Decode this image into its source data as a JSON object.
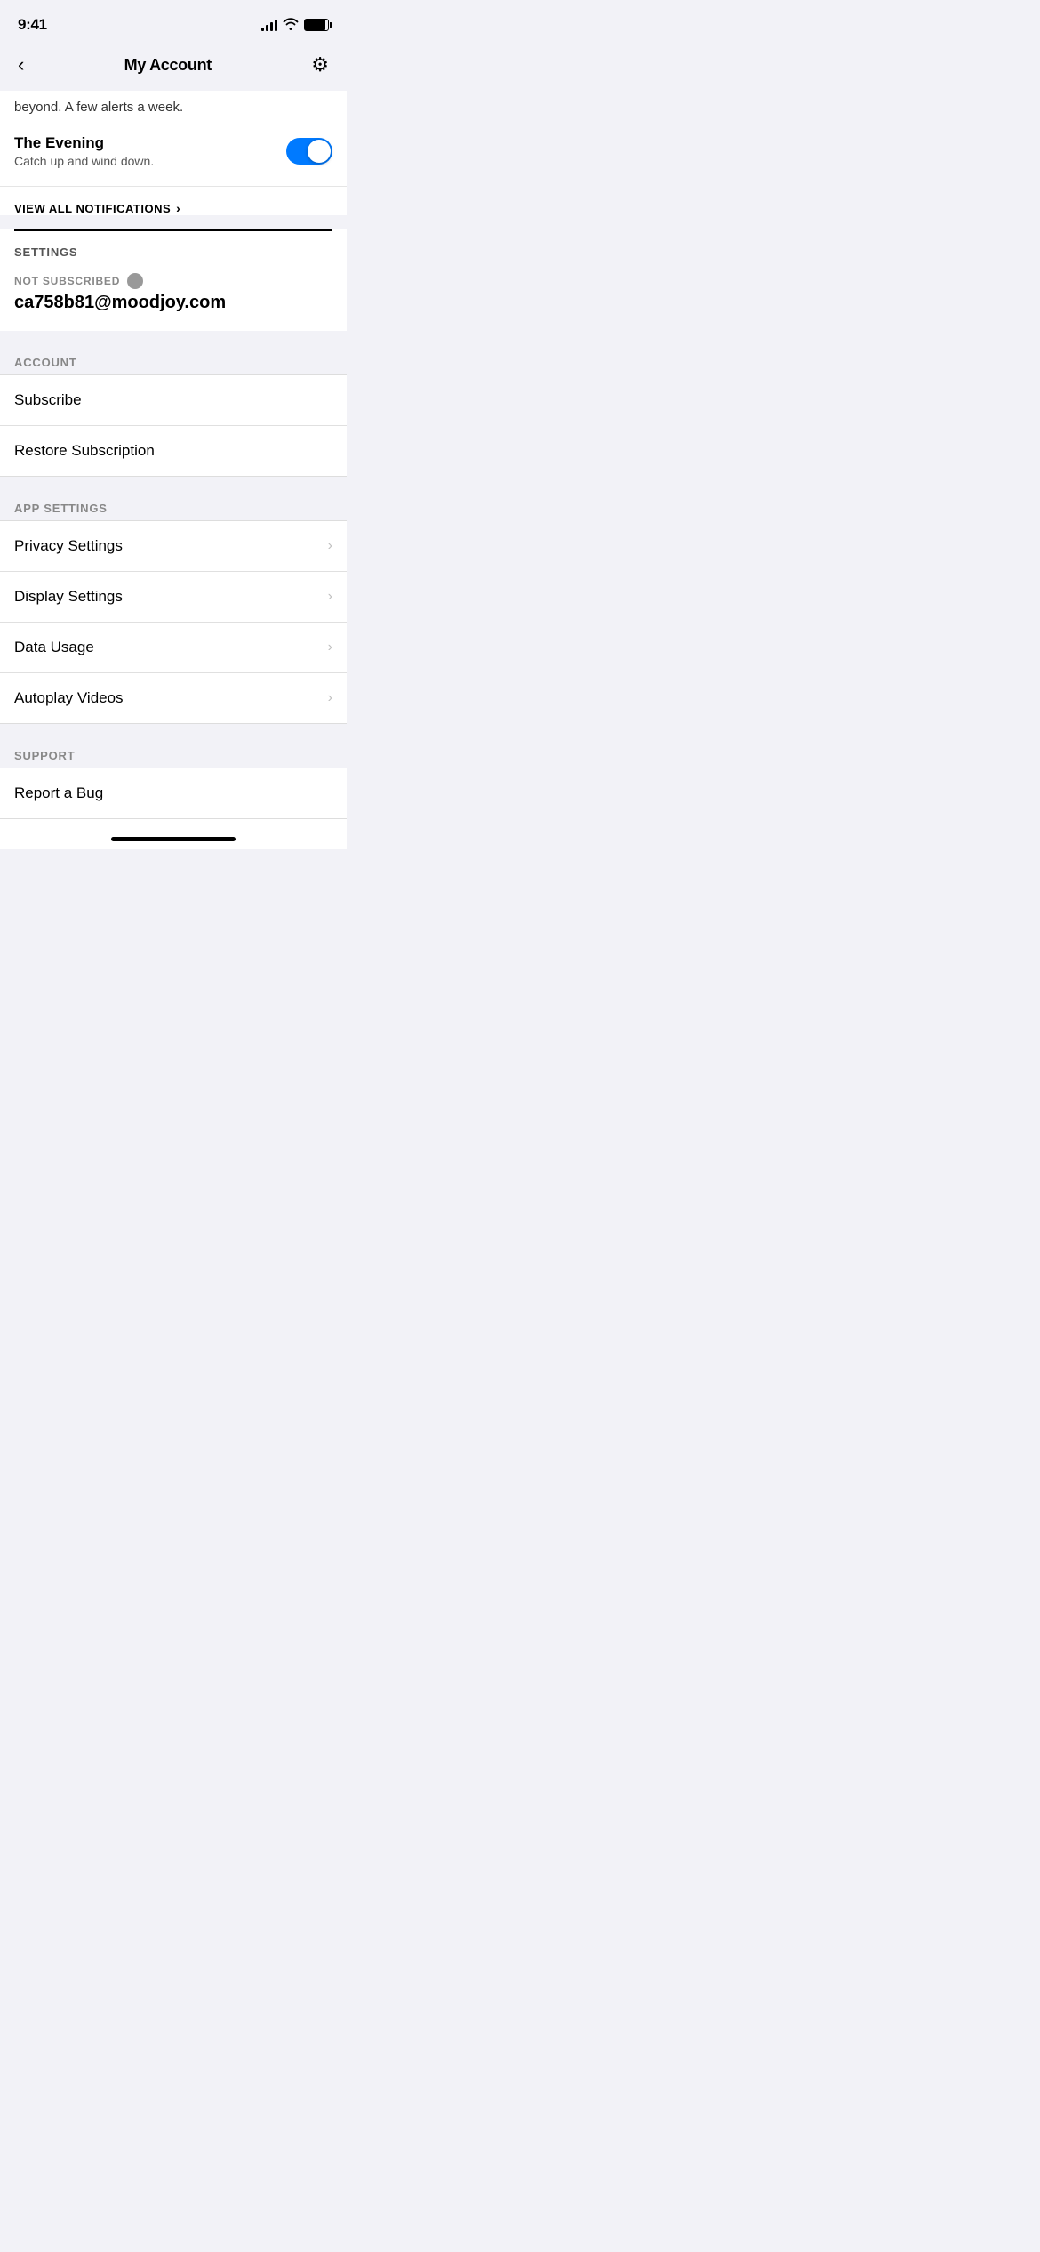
{
  "statusBar": {
    "time": "9:41"
  },
  "navBar": {
    "title": "My Account",
    "backLabel": "<",
    "gearLabel": "⚙"
  },
  "notificationsPartial": {
    "partialText": "beyond. A few alerts a week.",
    "eveningTitle": "The Evening",
    "eveningDesc": "Catch up and wind down.",
    "viewAllLabel": "VIEW ALL NOTIFICATIONS",
    "viewAllArrow": "›"
  },
  "settingsSection": {
    "sectionLabel": "SETTINGS",
    "subscriptionStatusLabel": "NOT SUBSCRIBED",
    "subscriptionEmail": "ca758b81@moodjoy.com"
  },
  "accountSection": {
    "sectionLabel": "ACCOUNT",
    "items": [
      {
        "label": "Subscribe",
        "hasChevron": false
      },
      {
        "label": "Restore Subscription",
        "hasChevron": false
      }
    ]
  },
  "appSettingsSection": {
    "sectionLabel": "APP SETTINGS",
    "items": [
      {
        "label": "Privacy Settings",
        "hasChevron": true
      },
      {
        "label": "Display Settings",
        "hasChevron": true
      },
      {
        "label": "Data Usage",
        "hasChevron": true
      },
      {
        "label": "Autoplay Videos",
        "hasChevron": true
      }
    ]
  },
  "supportSection": {
    "sectionLabel": "SUPPORT",
    "items": [
      {
        "label": "Report a Bug",
        "hasChevron": false
      }
    ]
  },
  "homeIndicator": {}
}
